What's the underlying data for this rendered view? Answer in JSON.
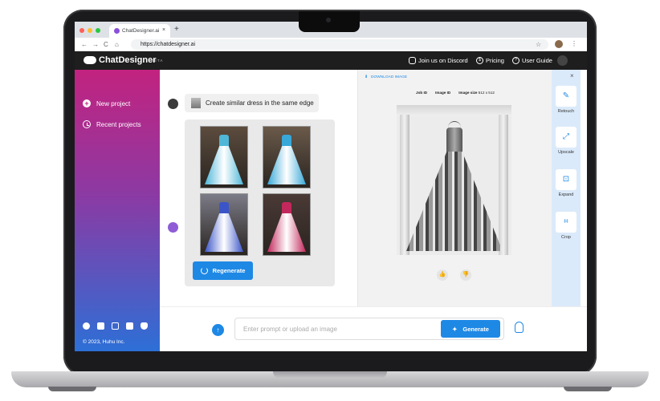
{
  "browser": {
    "tab_title": "ChatDesigner.ai",
    "tab_close": "×",
    "new_tab": "+",
    "url": "https://chatdesigner.ai",
    "nav": {
      "back": "←",
      "forward": "→",
      "reload": "C",
      "home": "⌂",
      "star": "☆",
      "menu": "⋮"
    }
  },
  "header": {
    "logo": "ChatDesigner",
    "beta": "BETA",
    "discord": "Join us on Discord",
    "pricing": "Pricing",
    "user_guide": "User Guide",
    "pricing_icon": "$",
    "guide_icon": "?"
  },
  "sidebar": {
    "new_project": "New project",
    "recent_projects": "Recent projects",
    "copyright": "© 2023, Huhu Inc.",
    "socials": [
      "facebook-icon",
      "twitter-icon",
      "instagram-icon",
      "tiktok-icon",
      "discord-icon"
    ],
    "gradient": [
      "#c2237f",
      "#8b3aa4",
      "#2d6fd6"
    ]
  },
  "chat": {
    "prompt": "Create similar dress in the same edge",
    "thumbnails": [
      {
        "color": "#4fb6d8",
        "bg": "#5c4c3e"
      },
      {
        "color": "#38a8d8",
        "bg": "#6a5a4a"
      },
      {
        "color": "#3b55c8",
        "bg": "#7c7c88"
      },
      {
        "color": "#c2285c",
        "bg": "#4a3a36"
      }
    ],
    "regenerate": "Regenerate"
  },
  "input": {
    "placeholder": "Enter prompt or upload an image",
    "value": "",
    "upload_icon": "↑",
    "generate": "Generate"
  },
  "preview": {
    "download": "DOWNLOAD IMAGE",
    "job_id": "Job ID",
    "image_id": "Image ID",
    "image_size_label": "Image size",
    "image_size_value": "512 x 512",
    "like": "👍",
    "dislike": "👎",
    "close": "×"
  },
  "tools": [
    {
      "label": "Retouch",
      "icon": "✎"
    },
    {
      "label": "Upscale",
      "icon": "⤢"
    },
    {
      "label": "Expand",
      "icon": "⊡"
    },
    {
      "label": "Crop",
      "icon": "⌗"
    }
  ],
  "colors": {
    "accent": "#1e88e5",
    "header_bg": "#1e1e1e",
    "toolbar_bg": "#dbeafa"
  }
}
